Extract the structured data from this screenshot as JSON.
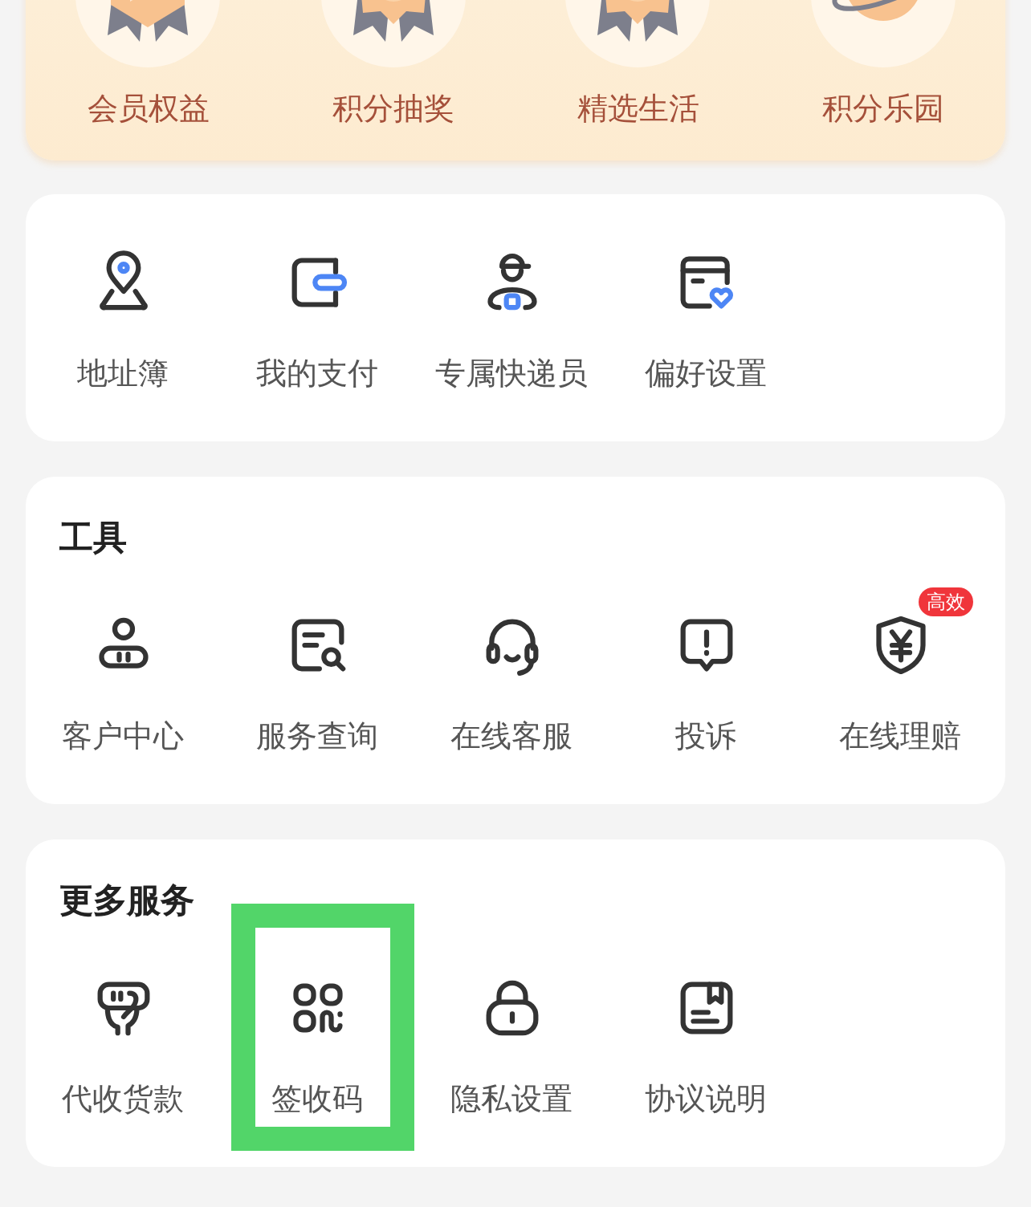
{
  "benefits": [
    {
      "label": "会员权益"
    },
    {
      "label": "积分抽奖"
    },
    {
      "label": "精选生活"
    },
    {
      "label": "积分乐园"
    }
  ],
  "shortcuts": [
    {
      "label": "地址簿"
    },
    {
      "label": "我的支付"
    },
    {
      "label": "专属快递员"
    },
    {
      "label": "偏好设置"
    }
  ],
  "sections": [
    {
      "title": "工具",
      "items": [
        {
          "label": "客户中心"
        },
        {
          "label": "服务查询"
        },
        {
          "label": "在线客服"
        },
        {
          "label": "投诉"
        },
        {
          "label": "在线理赔",
          "badge": "高效"
        }
      ]
    },
    {
      "title": "更多服务",
      "items": [
        {
          "label": "代收货款",
          "highlighted": false
        },
        {
          "label": "签收码",
          "highlighted": true
        },
        {
          "label": "隐私设置",
          "highlighted": false
        },
        {
          "label": "协议说明",
          "highlighted": false
        }
      ]
    }
  ]
}
